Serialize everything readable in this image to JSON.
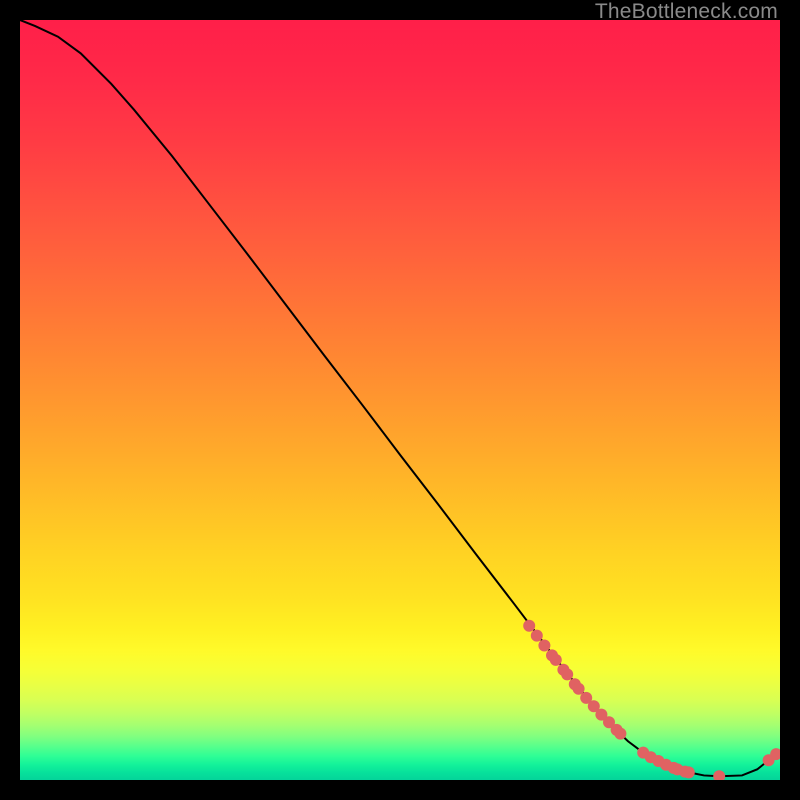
{
  "watermark": "TheBottleneck.com",
  "chart_data": {
    "type": "line",
    "title": "",
    "xlabel": "",
    "ylabel": "",
    "xlim": [
      0,
      100
    ],
    "ylim": [
      0,
      100
    ],
    "grid": false,
    "legend": false,
    "series": [
      {
        "name": "bottleneck-curve",
        "x": [
          0,
          2,
          5,
          8,
          12,
          15,
          20,
          25,
          30,
          35,
          40,
          45,
          50,
          55,
          60,
          65,
          70,
          73,
          76,
          78,
          80,
          82,
          85,
          88,
          90,
          92,
          95,
          97,
          98.5,
          100
        ],
        "y": [
          100,
          99.2,
          97.8,
          95.6,
          91.6,
          88.2,
          82.1,
          75.6,
          69.1,
          62.5,
          55.9,
          49.4,
          42.8,
          36.3,
          29.7,
          23.2,
          16.6,
          12.8,
          9.2,
          7.0,
          5.1,
          3.6,
          2.0,
          1.0,
          0.6,
          0.5,
          0.6,
          1.4,
          2.6,
          3.9
        ]
      }
    ],
    "scatter_points": {
      "name": "markers",
      "x": [
        67,
        68,
        69,
        70,
        70.5,
        71.5,
        72,
        73,
        73.5,
        74.5,
        75.5,
        76.5,
        77.5,
        78.5,
        79,
        82,
        83,
        84,
        85,
        86,
        86.5,
        87.5,
        88,
        92,
        98.5,
        99.5
      ],
      "y": [
        20.3,
        19.0,
        17.7,
        16.4,
        15.8,
        14.5,
        13.9,
        12.6,
        12.0,
        10.8,
        9.7,
        8.6,
        7.6,
        6.6,
        6.1,
        3.6,
        3.0,
        2.5,
        2.0,
        1.6,
        1.4,
        1.1,
        1.0,
        0.5,
        2.6,
        3.4
      ]
    },
    "gradient_stops": [
      {
        "offset": 0.0,
        "color": "#ff1f49"
      },
      {
        "offset": 0.08,
        "color": "#ff2a48"
      },
      {
        "offset": 0.16,
        "color": "#ff3b44"
      },
      {
        "offset": 0.24,
        "color": "#ff5040"
      },
      {
        "offset": 0.32,
        "color": "#ff653b"
      },
      {
        "offset": 0.4,
        "color": "#ff7b35"
      },
      {
        "offset": 0.48,
        "color": "#ff9130"
      },
      {
        "offset": 0.56,
        "color": "#ffa82b"
      },
      {
        "offset": 0.64,
        "color": "#ffc026"
      },
      {
        "offset": 0.7,
        "color": "#ffd223"
      },
      {
        "offset": 0.76,
        "color": "#ffe222"
      },
      {
        "offset": 0.8,
        "color": "#fff022"
      },
      {
        "offset": 0.83,
        "color": "#fffa2a"
      },
      {
        "offset": 0.855,
        "color": "#f6ff36"
      },
      {
        "offset": 0.875,
        "color": "#e9ff44"
      },
      {
        "offset": 0.895,
        "color": "#d8ff53"
      },
      {
        "offset": 0.912,
        "color": "#c1ff62"
      },
      {
        "offset": 0.928,
        "color": "#a4ff71"
      },
      {
        "offset": 0.942,
        "color": "#82ff7f"
      },
      {
        "offset": 0.955,
        "color": "#5aff8b"
      },
      {
        "offset": 0.968,
        "color": "#30fe95"
      },
      {
        "offset": 0.98,
        "color": "#13f29a"
      },
      {
        "offset": 0.99,
        "color": "#07e19b"
      },
      {
        "offset": 1.0,
        "color": "#04d49a"
      }
    ],
    "marker_color": "#e06262",
    "curve_color": "#000000"
  }
}
